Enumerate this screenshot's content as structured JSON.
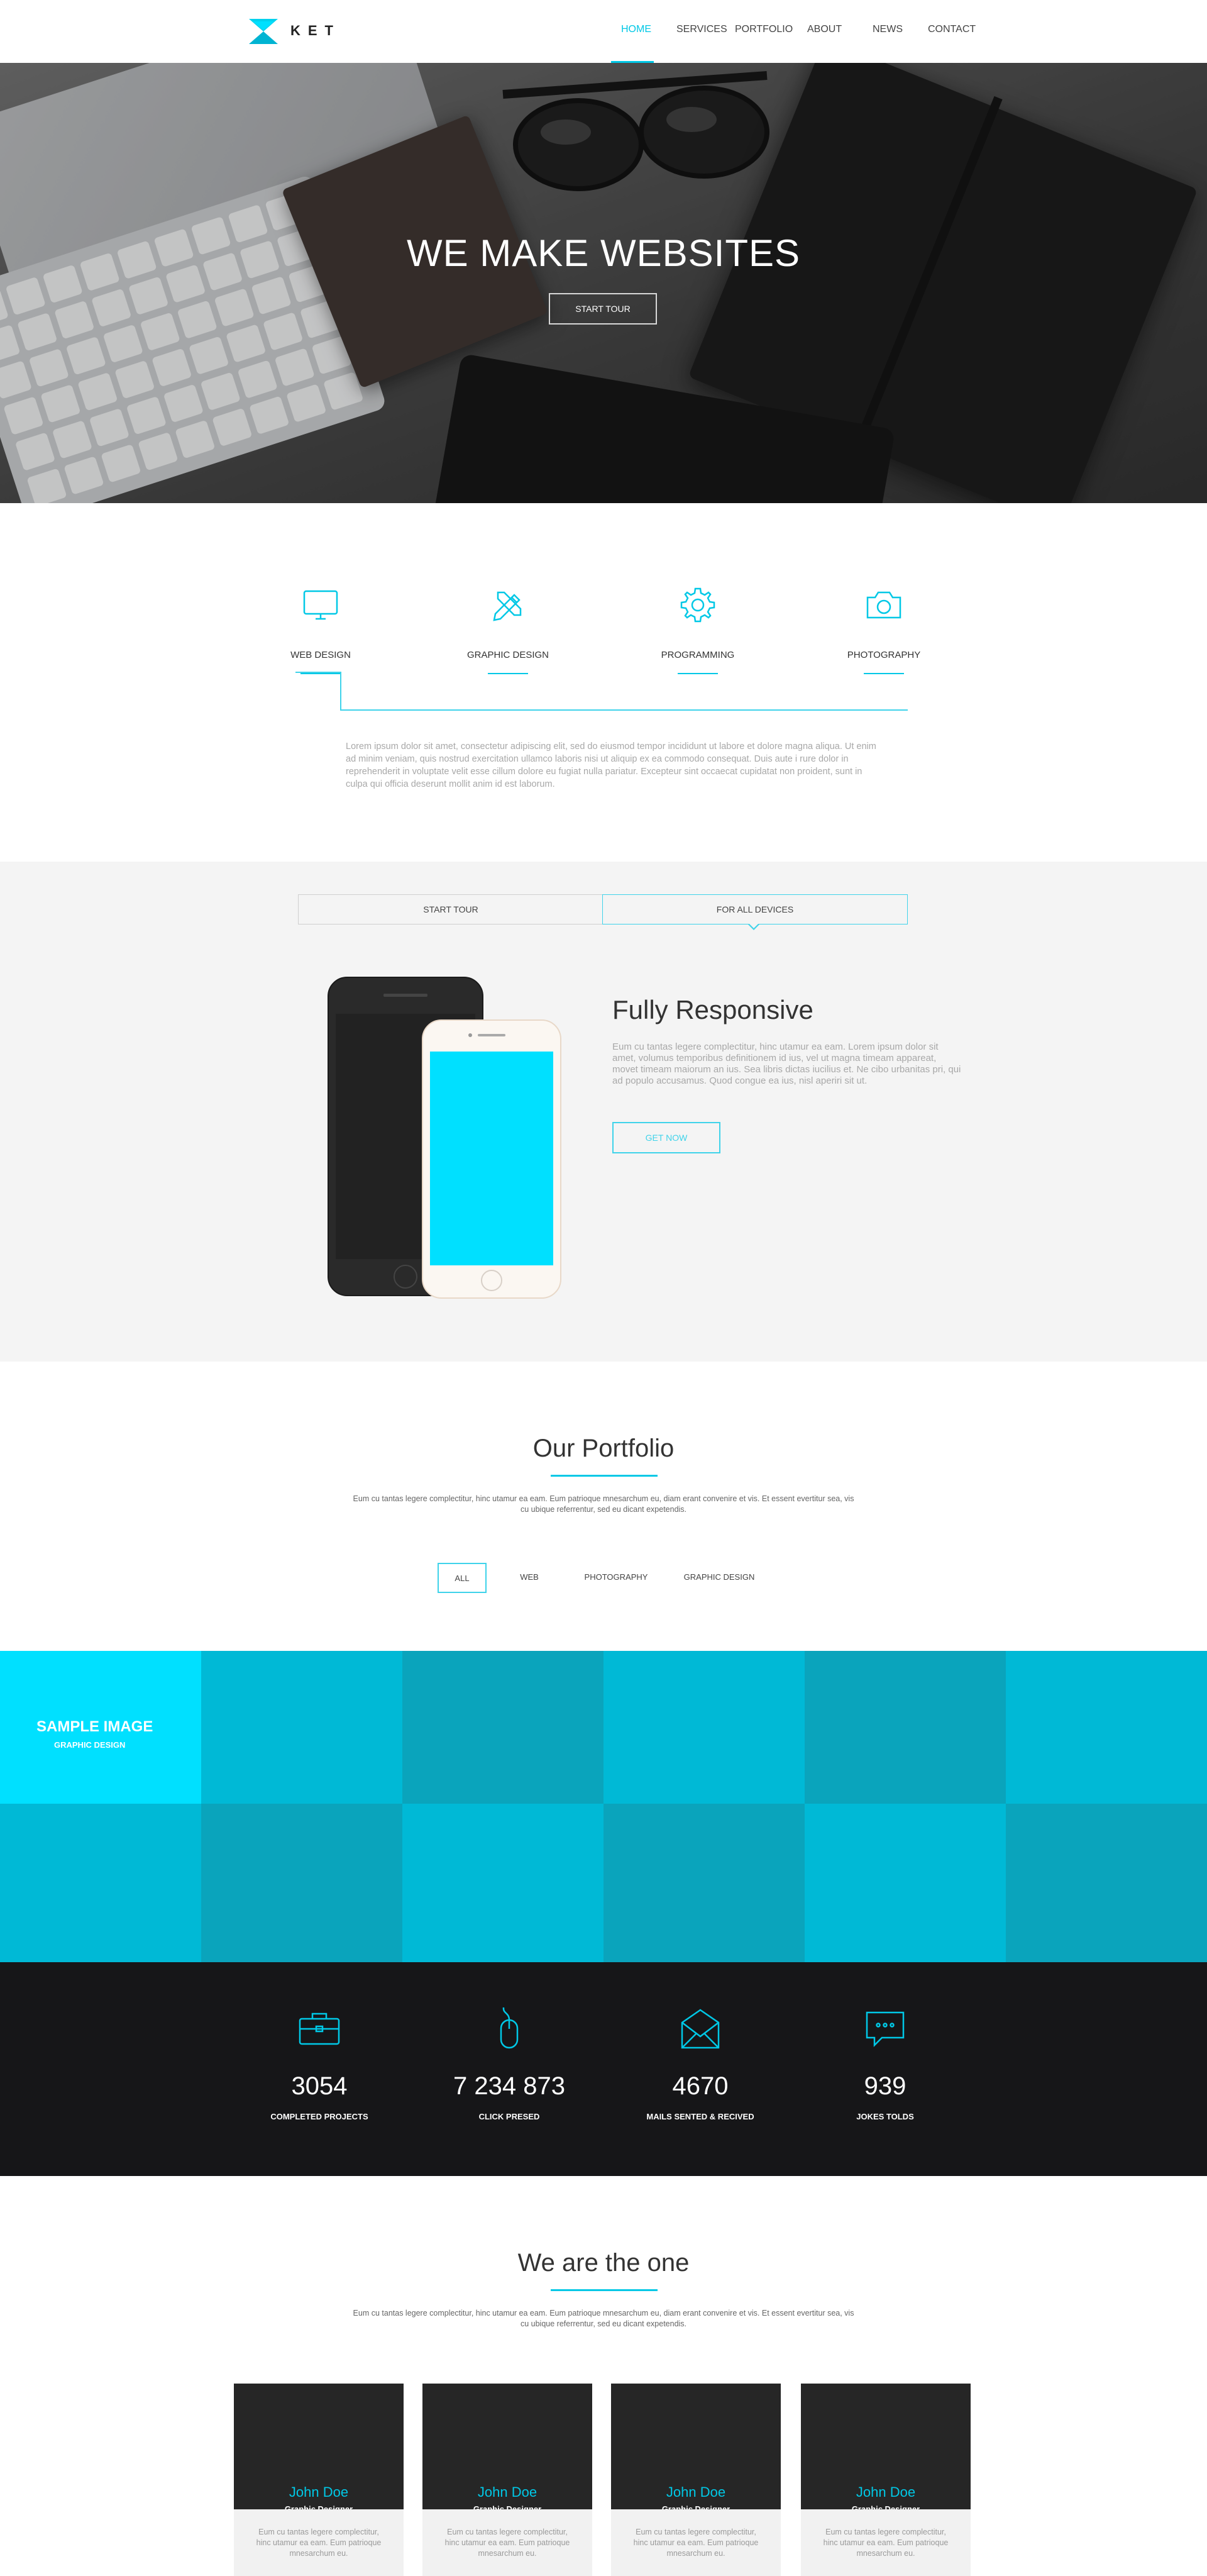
{
  "nav": {
    "brand": "KET",
    "items": [
      {
        "label": "HOME",
        "active": true
      },
      {
        "label": "SERVICES",
        "active": false
      },
      {
        "label": "PORTFOLIO",
        "active": false
      },
      {
        "label": "ABOUT",
        "active": false
      },
      {
        "label": "NEWS",
        "active": false
      },
      {
        "label": "CONTACT",
        "active": false
      }
    ]
  },
  "hero": {
    "title": "WE MAKE WEBSITES",
    "button": "START TOUR"
  },
  "services": {
    "items": [
      {
        "label": "WEB DESIGN",
        "icon": "monitor-icon"
      },
      {
        "label": "GRAPHIC DESIGN",
        "icon": "pencil-ruler-icon"
      },
      {
        "label": "PROGRAMMING",
        "icon": "gear-icon"
      },
      {
        "label": "PHOTOGRAPHY",
        "icon": "camera-icon"
      }
    ],
    "description": "Lorem ipsum dolor sit amet, consectetur adipiscing elit, sed do eiusmod tempor incididunt ut labore et dolore magna aliqua. Ut enim ad minim veniam, quis nostrud exercitation ullamco laboris nisi ut aliquip ex ea commodo consequat. Duis aute i rure dolor in reprehenderit in voluptate velit esse cillum dolore eu fugiat nulla pariatur. Excepteur sint occaecat cupidatat non proident, sunt in culpa qui officia deserunt mollit anim id est laborum."
  },
  "devices": {
    "tabs": [
      {
        "label": "START TOUR",
        "active": false
      },
      {
        "label": "FOR ALL DEVICES",
        "active": true
      }
    ],
    "title": "Fully Responsive",
    "text": "Eum cu tantas legere complectitur, hinc utamur ea eam. Lorem ipsum dolor sit amet, volumus temporibus definitionem id ius, vel ut magna timeam appareat, movet timeam maiorum an ius. Sea libris dictas iucilius et. Ne cibo urbanitas pri, qui ad populo accusamus. Quod congue ea ius, nisl aperiri sit ut.",
    "button": "GET NOW",
    "accent": "#00e0ff"
  },
  "portfolio": {
    "title": "Our Portfolio",
    "text": "Eum cu tantas legere complectitur, hinc utamur ea eam. Eum patrioque mnesarchum eu, diam erant convenire et vis. Et essent evertitur sea, vis cu ubique referrentur, sed eu dicant expetendis.",
    "filters": [
      {
        "label": "ALL",
        "active": true
      },
      {
        "label": "WEB",
        "active": false
      },
      {
        "label": "PHOTOGRAPHY",
        "active": false
      },
      {
        "label": "GRAPHIC DESIGN",
        "active": false
      }
    ],
    "grid": {
      "featured_title": "SAMPLE IMAGE",
      "featured_subtitle": "GRAPHIC DESIGN",
      "row1": [
        "#00e0ff",
        "#00b9d6",
        "#0aa4bc",
        "#00b9d6",
        "#0aa4bc",
        "#00b9d6"
      ],
      "row2": [
        "#00b9d6",
        "#0aa4bc",
        "#00b9d6",
        "#0aa4bc",
        "#00b9d6",
        "#0aa4bc"
      ]
    }
  },
  "stats": [
    {
      "value": "3054",
      "label": "COMPLETED PROJECTS",
      "icon": "briefcase-icon"
    },
    {
      "value": "7 234 873",
      "label": "CLICK PRESED",
      "icon": "mouse-icon"
    },
    {
      "value": "4670",
      "label": "MAILS SENTED & RECIVED",
      "icon": "mail-icon"
    },
    {
      "value": "939",
      "label": "JOKES TOLDS",
      "icon": "chat-icon"
    }
  ],
  "team": {
    "title": "We are the one",
    "text": "Eum cu tantas legere complectitur, hinc utamur ea eam. Eum patrioque mnesarchum eu, diam erant convenire et vis. Et essent evertitur sea, vis cu ubique referrentur, sed eu dicant expetendis.",
    "members": [
      {
        "name": "John Doe",
        "role": "Graphic Designer",
        "bio": "Eum cu tantas legere complectitur, hinc utamur ea eam. Eum patrioque mnesarchum eu."
      },
      {
        "name": "John Doe",
        "role": "Graphic Designer",
        "bio": "Eum cu tantas legere complectitur, hinc utamur ea eam. Eum patrioque mnesarchum eu."
      },
      {
        "name": "John Doe",
        "role": "Graphic Designer",
        "bio": "Eum cu tantas legere complectitur, hinc utamur ea eam. Eum patrioque mnesarchum eu."
      },
      {
        "name": "John Doe",
        "role": "Graphic Designer",
        "bio": "Eum cu tantas legere complectitur, hinc utamur ea eam. Eum patrioque mnesarchum eu."
      }
    ]
  },
  "colors": {
    "accent": "#00c8e6",
    "dark": "#161618",
    "light": "#f4f4f4"
  }
}
